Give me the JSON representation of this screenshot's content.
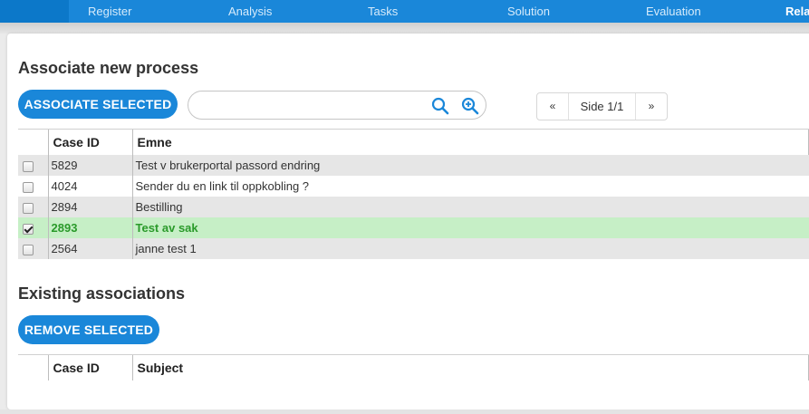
{
  "nav": {
    "tabs": [
      {
        "label": "Register",
        "active": false
      },
      {
        "label": "Analysis",
        "active": false
      },
      {
        "label": "Tasks",
        "active": false
      },
      {
        "label": "Solution",
        "active": false
      },
      {
        "label": "Evaluation",
        "active": false
      },
      {
        "label": "Rela",
        "active": true
      }
    ]
  },
  "associate": {
    "title": "Associate new process",
    "button_label": "ASSOCIATE SELECTED",
    "search": {
      "value": "",
      "placeholder": ""
    },
    "pager": {
      "prev": "«",
      "info": "Side 1/1",
      "next": "»"
    },
    "columns": [
      "Case ID",
      "Emne"
    ],
    "rows": [
      {
        "id": "5829",
        "subject": "Test v brukerportal passord endring",
        "checked": false
      },
      {
        "id": "4024",
        "subject": "Sender du en link til oppkobling ?",
        "checked": false
      },
      {
        "id": "2894",
        "subject": "Bestilling",
        "checked": false
      },
      {
        "id": "2893",
        "subject": "Test av sak",
        "checked": true
      },
      {
        "id": "2564",
        "subject": "janne test 1",
        "checked": false
      }
    ]
  },
  "existing": {
    "title": "Existing associations",
    "button_label": "REMOVE SELECTED",
    "columns": [
      "Case ID",
      "Subject"
    ]
  },
  "colors": {
    "accent": "#1a87d9",
    "selected_row": "#c6efc6",
    "selected_text": "#2a9a2a"
  },
  "icons": {
    "search": "search-icon",
    "zoom": "zoom-in-icon"
  }
}
